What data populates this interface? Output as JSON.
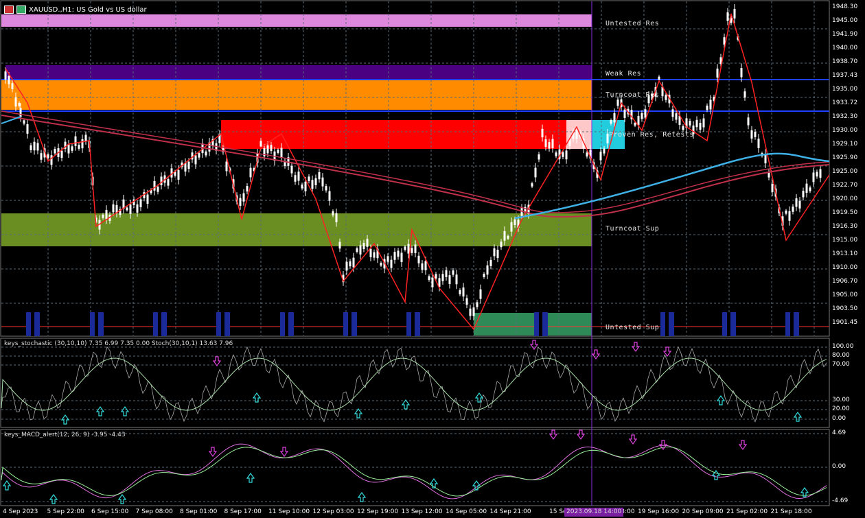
{
  "window": {
    "title": "XAUUSD.,H1: US Gold vs US dollar"
  },
  "colors": {
    "background": "#000000",
    "grid": "#5a6b78",
    "up": "#ffffff",
    "down": "#ffffff",
    "ma": "#d23c5a",
    "ma_fast": "#3fb0e6",
    "accent": "#8a2be2"
  },
  "main": {
    "price_axis": [
      "1948.30",
      "1945.00",
      "1941.90",
      "1940.00",
      "1938.70",
      "1937.43",
      "1935.00",
      "1933.72",
      "1932.30",
      "1930.00",
      "1929.10",
      "1925.90",
      "1925.00",
      "1922.70",
      "1920.00",
      "1919.50",
      "1916.30",
      "1915.00",
      "1913.10",
      "1910.00",
      "1906.70",
      "1905.00",
      "1903.50",
      "1901.45"
    ],
    "zones": [
      {
        "name": "untested-res",
        "label": "Untested Res",
        "color": "#dd88dd"
      },
      {
        "name": "weak-res",
        "label": "Weak Res",
        "color": "#4b0082"
      },
      {
        "name": "turncoat-res",
        "label": "Turncoat Res",
        "color": "#ff8c00"
      },
      {
        "name": "proven-res",
        "label": "Proven Res, Retests",
        "color": "#ff0000"
      },
      {
        "name": "turncoat-sup",
        "label": "Turncoat Sup",
        "color": "#6b8e23"
      },
      {
        "name": "untested-sup",
        "label": "Untested Sup",
        "color": "#2e8b57"
      }
    ]
  },
  "stoch": {
    "label": "keys_stochastic (30,10,10) 7.35 6.99 7.35 0.00 Stoch(30,10,1) 13.63 7.96",
    "levels": [
      "100.00",
      "80.00",
      "70.00",
      "30.00",
      "20.00",
      "0.00"
    ]
  },
  "macd": {
    "label": "keys_MACD_alert(12, 26, 9) -3.95 -4.43",
    "levels": [
      "4.69",
      "0.00",
      "-4.69"
    ]
  },
  "time_axis": [
    "4 Sep 2023",
    "5 Sep 22:00",
    "6 Sep 15:00",
    "7 Sep 08:00",
    "8 Sep 01:00",
    "8 Sep 17:00",
    "11 Sep 10:00",
    "12 Sep 03:00",
    "12 Sep 19:00",
    "13 Sep 12:00",
    "14 Sep 05:00",
    "14 Sep 21:00",
    "15 Sep 14:00",
    "18 Sep 23:00",
    "19 Sep 16:00",
    "20 Sep 09:00",
    "21 Sep 02:00",
    "21 Sep 18:00"
  ],
  "cursor_time": "2023.09.18 14:00"
}
